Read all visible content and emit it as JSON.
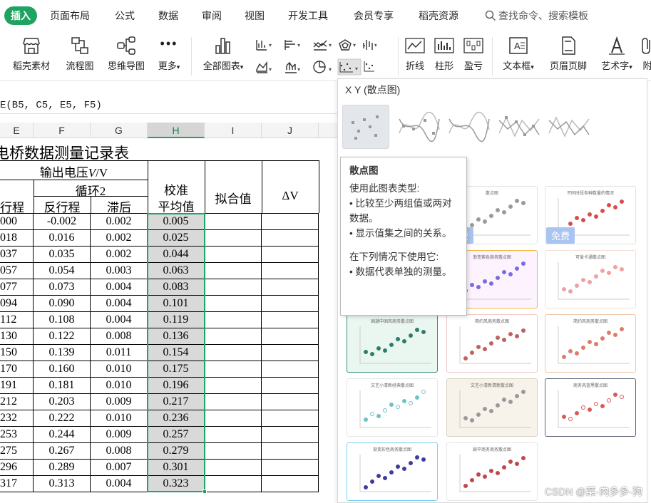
{
  "menu": {
    "tabs": [
      "插入",
      "页面布局",
      "公式",
      "数据",
      "审阅",
      "视图",
      "开发工具",
      "会员专享",
      "稻壳资源"
    ],
    "search_placeholder": "查找命令、搜索模板"
  },
  "ribbon": {
    "buttons": {
      "daoke": "稻壳素材",
      "flowchart": "流程图",
      "mindmap": "思维导图",
      "more": "更多",
      "all_charts": "全部图表",
      "line_spark": "折线",
      "column_spark": "柱形",
      "winloss_spark": "盈亏",
      "textbox": "文本框",
      "header_footer": "页眉页脚",
      "wordart": "艺术字",
      "attach": "附"
    }
  },
  "formula_bar": {
    "text": "E(B5, C5, E5, F5)"
  },
  "sheet": {
    "columns": [
      "E",
      "F",
      "G",
      "H",
      "I",
      "J"
    ],
    "title": "电桥数据测量记录表",
    "output_voltage_label": "输出电压",
    "output_voltage_symbol": "V",
    "output_voltage_unit": "/V",
    "cycle2_label": "循环2",
    "calib_label_1": "校准",
    "calib_label_2": "平均值",
    "fit_label": "拟合值",
    "delta_label": "ΔV",
    "sub_headers": [
      "行程",
      "反行程",
      "滞后"
    ],
    "rows": [
      [
        "000",
        "-0.002",
        "0.002",
        "0.005"
      ],
      [
        "018",
        "0.016",
        "0.002",
        "0.025"
      ],
      [
        "037",
        "0.035",
        "0.002",
        "0.044"
      ],
      [
        "057",
        "0.054",
        "0.003",
        "0.063"
      ],
      [
        "077",
        "0.073",
        "0.004",
        "0.083"
      ],
      [
        "094",
        "0.090",
        "0.004",
        "0.101"
      ],
      [
        "112",
        "0.108",
        "0.004",
        "0.119"
      ],
      [
        "130",
        "0.122",
        "0.008",
        "0.136"
      ],
      [
        "150",
        "0.139",
        "0.011",
        "0.154"
      ],
      [
        "170",
        "0.160",
        "0.010",
        "0.175"
      ],
      [
        "191",
        "0.181",
        "0.010",
        "0.196"
      ],
      [
        "212",
        "0.203",
        "0.009",
        "0.217"
      ],
      [
        "232",
        "0.222",
        "0.010",
        "0.236"
      ],
      [
        "253",
        "0.244",
        "0.009",
        "0.257"
      ],
      [
        "275",
        "0.267",
        "0.008",
        "0.279"
      ],
      [
        "296",
        "0.289",
        "0.007",
        "0.301"
      ],
      [
        "317",
        "0.313",
        "0.004",
        "0.323"
      ]
    ]
  },
  "chart_panel": {
    "title": "X Y (散点图)",
    "free_badge": "免费",
    "tooltip": {
      "heading": "散点图",
      "body_1": "使用此图表类型:",
      "body_2": "• 比较至少两组值或两对数据。",
      "body_3": "• 显示值集之间的关系。",
      "body_4": "在下列情况下使用它:",
      "body_5": "• 数据代表单独的测量。"
    },
    "template_titles": [
      "散点图",
      "不同时段各种数量的情况",
      "文艺小清新经典散点图",
      "渐变紫色商务散点图",
      "可爱卡通散点图",
      "国潮中国风商务散点图",
      "简约风商务散点图",
      "简约风商务散点图",
      "文艺小清新经典散点图",
      "文艺小清新清新散点图",
      "商务风蓝黑散点图",
      "渐变彩色商务散点图",
      "扁平商务商务散点图"
    ],
    "colors": {
      "accent_green": "#1fa361",
      "selected_col": "#d9d9d9",
      "selection_border": "#21a366"
    }
  },
  "watermark": "CSDN @菜·肉多多·狗"
}
